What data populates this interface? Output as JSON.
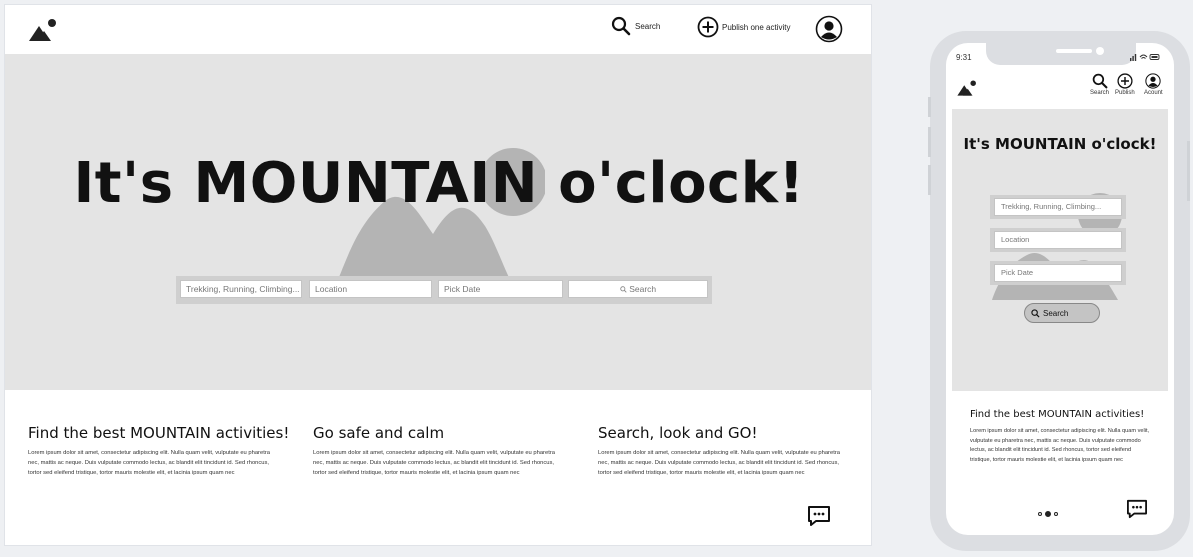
{
  "desktop": {
    "header": {
      "search_label": "Search",
      "publish_label": "Publish one activity"
    },
    "hero": {
      "title": "It's MOUNTAIN o'clock!",
      "search_bar": {
        "activity_placeholder": "Trekking, Running, Climbing...",
        "location_placeholder": "Location",
        "date_placeholder": "Pick Date",
        "search_button": "Search"
      }
    },
    "info_columns": [
      {
        "title": "Find the best MOUNTAIN activities!",
        "body": "Lorem ipsum dolor sit amet, consectetur adipiscing elit. Nulla quam velit, vulputate eu pharetra nec, mattis ac neque. Duis vulputate commodo lectus, ac blandit elit tincidunt id. Sed rhoncus, tortor sed eleifend tristique, tortor mauris molestie elit, et lacinia ipsum quam nec"
      },
      {
        "title": "Go safe and calm",
        "body": "Lorem ipsum dolor sit amet, consectetur adipiscing elit. Nulla quam velit, vulputate eu pharetra nec, mattis ac neque. Duis vulputate commodo lectus, ac blandit elit tincidunt id. Sed rhoncus, tortor sed eleifend tristique, tortor mauris molestie elit, et lacinia ipsum quam nec"
      },
      {
        "title": "Search, look and GO!",
        "body": "Lorem ipsum dolor sit amet, consectetur adipiscing elit. Nulla quam velit, vulputate eu pharetra nec, mattis ac neque. Duis vulputate commodo lectus, ac blandit elit tincidunt id. Sed rhoncus, tortor sed eleifend tristique, tortor mauris molestie elit, et lacinia ipsum quam nec"
      }
    ]
  },
  "mobile": {
    "status": {
      "time": "9:31"
    },
    "header": {
      "search_label": "Search",
      "publish_label": "Publish",
      "account_label": "Acount"
    },
    "hero": {
      "title": "It's MOUNTAIN o'clock!",
      "activity_placeholder": "Trekking, Running, Climbing...",
      "location_placeholder": "Location",
      "date_placeholder": "Pick Date",
      "search_button": "Search"
    },
    "info": {
      "title": "Find the best MOUNTAIN activities!",
      "body": "Lorem ipsum dolor sit amet, consectetur adipiscing elit. Nulla quam velit, vulputate eu pharetra nec, mattis ac neque. Duis vulputate commodo lectus, ac blandit elit tincidunt id. Sed rhoncus, tortor sed eleifend tristique, tortor mauris molestie elit, et lacinia ipsum quam nec"
    },
    "carousel": {
      "total": 3,
      "active": 2
    }
  },
  "icons": {
    "logo": "mountain-logo-icon",
    "search": "search-icon",
    "publish": "plus-circle-icon",
    "account": "account-icon",
    "chat": "chat-icon"
  },
  "colors": {
    "hero_bg": "#e4e4e4",
    "placeholder_shape": "#b4b4b4",
    "frame_bg": "#eef0f3",
    "text": "#111111"
  }
}
